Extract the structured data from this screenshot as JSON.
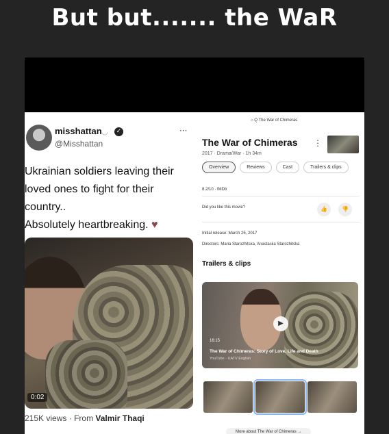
{
  "caption": "But but....... the WaR",
  "tweet": {
    "display_name": "misshattan",
    "verified_emoji": "◡",
    "verified_check": "✓",
    "handle": "@Misshattan",
    "more": "···",
    "text": "Ukrainian soldiers leaving their\nloved ones to fight for their\ncountry..\nAbsolutely heartbreaking.",
    "heart": "♥",
    "video_time": "0:02",
    "views": "215K views",
    "from_label": "From",
    "from_name": "Valmir Thaqi"
  },
  "google": {
    "url": "⌂ Q The War of Chimeras",
    "title": "The War of Chimeras",
    "kebab": "⋮",
    "subtitle": "2017 · Drama/War · 1h 34m",
    "chips": [
      "Overview",
      "Reviews",
      "Cast",
      "Trailers & clips"
    ],
    "rating": "8.2/10 · IMDb",
    "question": "Did you like this movie?",
    "thumb_up": "👍",
    "thumb_down": "👎",
    "initial_release": "Initial release: March 25, 2017",
    "directors": "Directors: Maria Starozhitska, Anastasiia Starozhitska",
    "section_title": "Trailers & clips",
    "video": {
      "play": "▶",
      "time": "16:15",
      "title": "The War of Chimeras: Story of Love, Life and Death",
      "source": "YouTube · UATV English"
    },
    "more_about": "More about The War of Chimeras →"
  },
  "colors": {
    "page_background": "#242424",
    "chip_active_border": "#555555",
    "selected_thumb_outline": "#8ab4f8"
  }
}
